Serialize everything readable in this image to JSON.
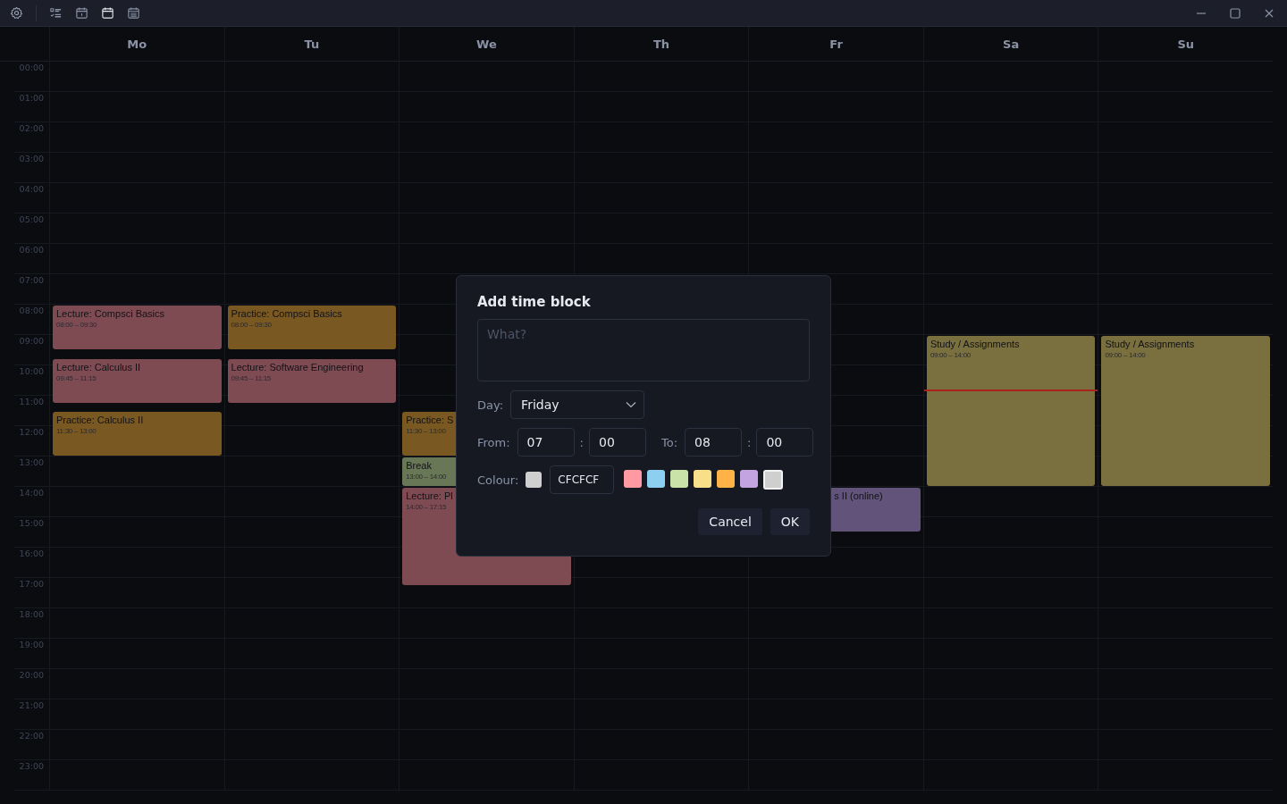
{
  "toolbar": {
    "views": [
      {
        "kind": "list",
        "selected": false
      },
      {
        "kind": "day",
        "selected": false
      },
      {
        "kind": "week",
        "selected": true
      },
      {
        "kind": "month",
        "selected": false
      }
    ]
  },
  "calendar": {
    "hours": [
      "00:00",
      "01:00",
      "02:00",
      "03:00",
      "04:00",
      "05:00",
      "06:00",
      "07:00",
      "08:00",
      "09:00",
      "10:00",
      "11:00",
      "12:00",
      "13:00",
      "14:00",
      "15:00",
      "16:00",
      "17:00",
      "18:00",
      "19:00",
      "20:00",
      "21:00",
      "22:00",
      "23:00"
    ],
    "days": [
      {
        "label": "Mo",
        "now_line": false,
        "events": [
          {
            "title": "Lecture: Compsci Basics",
            "time": "08:00 – 09:30",
            "color": "#7f4b53"
          },
          {
            "title": "Lecture: Calculus II",
            "time": "09:45 – 11:15",
            "color": "#7f4b53"
          },
          {
            "title": "Practice: Calculus II",
            "time": "11:30 – 13:00",
            "color": "#7a5822"
          }
        ]
      },
      {
        "label": "Tu",
        "now_line": false,
        "events": [
          {
            "title": "Practice: Compsci Basics",
            "time": "08:00 – 09:30",
            "color": "#7a5822"
          },
          {
            "title": "Lecture: Software Engineering",
            "time": "09:45 – 11:15",
            "color": "#7f4b53"
          }
        ]
      },
      {
        "label": "We",
        "now_line": false,
        "events": [
          {
            "title": "Practice: S",
            "time": "11:30 – 13:00",
            "color": "#7a5822"
          },
          {
            "title": "Break",
            "time": "13:00 – 14:00",
            "color": "#687755"
          },
          {
            "title": "Lecture: Pl",
            "time": "14:00 – 17:15",
            "color": "#7f4b53"
          }
        ]
      },
      {
        "label": "Th",
        "now_line": false
      },
      {
        "label": "Fr",
        "now_line": false,
        "events": [
          {
            "title": "s II (online)",
            "kind": "covered",
            "color": "#62537a"
          }
        ]
      },
      {
        "label": "Sa",
        "now_line": true,
        "events": [
          {
            "title": "Study / Assignments",
            "time": "09:00 – 14:00",
            "color": "#7a6f3e"
          }
        ]
      },
      {
        "label": "Su",
        "now_line": false,
        "events": [
          {
            "title": "Study / Assignments",
            "time": "09:00 – 14:00",
            "color": "#7a6f3e"
          }
        ]
      }
    ]
  },
  "dialog": {
    "title": "Add time block",
    "what": {
      "placeholder": "What?"
    },
    "day_label": "Day:",
    "day": "Friday",
    "from_label": "From:",
    "from_hour": "07",
    "from_minute": "00",
    "to_label": "To:",
    "to_hour": "08",
    "to_minute": "00",
    "separator": ":",
    "colour_label": "Colour:",
    "colour_hex": "CFCFCF",
    "palette": [
      {
        "color": "#ff9aa2",
        "selected": false
      },
      {
        "color": "#8ccff0",
        "selected": false
      },
      {
        "color": "#c8e2a8",
        "selected": false
      },
      {
        "color": "#f8e08a",
        "selected": false
      },
      {
        "color": "#ffb347",
        "selected": false
      },
      {
        "color": "#c3a4e0",
        "selected": false
      },
      {
        "color": "#cfcfcf",
        "selected": true
      }
    ],
    "buttons": [
      "Cancel",
      "OK"
    ]
  }
}
